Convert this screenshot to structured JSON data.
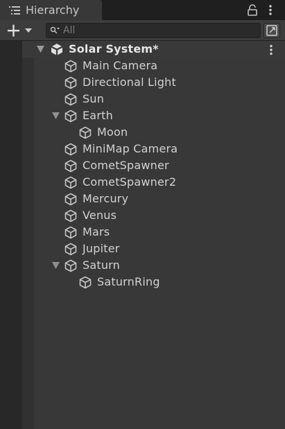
{
  "tab": {
    "title": "Hierarchy",
    "icon": "hierarchy-list-icon"
  },
  "tab_actions": {
    "lock_icon": "lock-icon",
    "menu_icon": "kebab-menu-icon"
  },
  "toolbar": {
    "add_icon": "plus-icon",
    "dropdown_icon": "caret-down-icon",
    "search": {
      "placeholder": "All",
      "value": "",
      "icon": "search-icon"
    },
    "scene_filter_icon": "scene-filter-icon"
  },
  "scene": {
    "name": "Solar System*",
    "expanded": true,
    "icon": "unity-scene-icon",
    "menu_icon": "kebab-menu-icon"
  },
  "items": [
    {
      "label": "Main Camera",
      "depth": 1,
      "has_children": false
    },
    {
      "label": "Directional Light",
      "depth": 1,
      "has_children": false
    },
    {
      "label": "Sun",
      "depth": 1,
      "has_children": false
    },
    {
      "label": "Earth",
      "depth": 1,
      "has_children": true,
      "expanded": true
    },
    {
      "label": "Moon",
      "depth": 2,
      "has_children": false
    },
    {
      "label": "MiniMap Camera",
      "depth": 1,
      "has_children": false
    },
    {
      "label": "CometSpawner",
      "depth": 1,
      "has_children": false
    },
    {
      "label": "CometSpawner2",
      "depth": 1,
      "has_children": false
    },
    {
      "label": "Mercury",
      "depth": 1,
      "has_children": false
    },
    {
      "label": "Venus",
      "depth": 1,
      "has_children": false
    },
    {
      "label": "Mars",
      "depth": 1,
      "has_children": false
    },
    {
      "label": "Jupiter",
      "depth": 1,
      "has_children": false
    },
    {
      "label": "Saturn",
      "depth": 1,
      "has_children": true,
      "expanded": true
    },
    {
      "label": "SaturnRing",
      "depth": 2,
      "has_children": false
    }
  ],
  "colors": {
    "panel_bg": "#383838",
    "tab_bg": "#383838",
    "tabbar_bg": "#1f1f1f",
    "toolbar_bg": "#3c3c3c",
    "text": "#d2d2d2",
    "icon": "#c4c4c4"
  }
}
